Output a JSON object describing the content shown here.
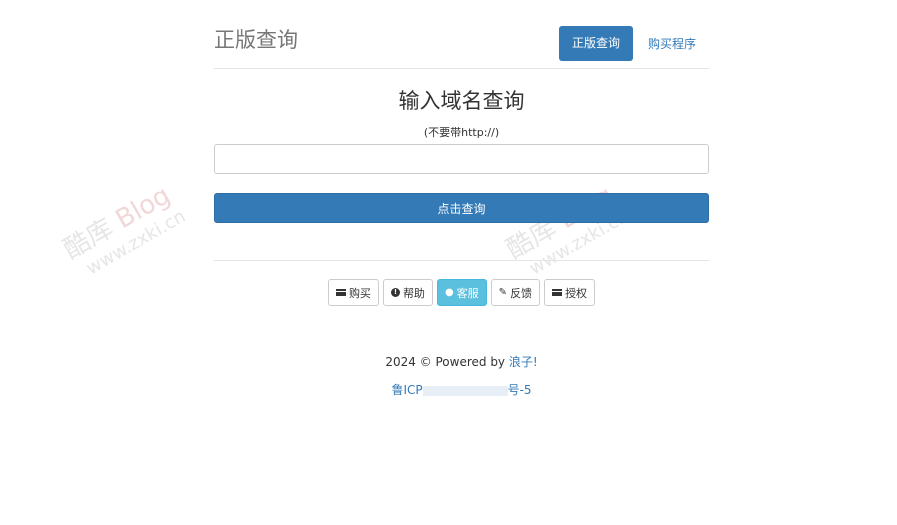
{
  "header": {
    "brand": "正版查询",
    "nav": {
      "active_label": "正版查询",
      "link_label": "购买程序"
    }
  },
  "main": {
    "title": "输入域名查询",
    "hint": "(不要带http://)",
    "input": {
      "value": "",
      "placeholder": ""
    },
    "submit_label": "点击查询"
  },
  "actions": [
    {
      "label": "购买",
      "icon": "card-icon"
    },
    {
      "label": "帮助",
      "icon": "help-circle-icon"
    },
    {
      "label": "客服",
      "icon": "user-icon"
    },
    {
      "label": "反馈",
      "icon": "pencil-icon"
    },
    {
      "label": "授权",
      "icon": "card-icon"
    }
  ],
  "footer": {
    "copyright": "2024 © Powered by",
    "author": "浪子!",
    "icp_prefix": "鲁ICP",
    "icp_suffix": "号-5"
  },
  "watermark": {
    "text_cn": "酷库",
    "text_blog": "Blog",
    "url": "www.zxki.cn"
  },
  "colors": {
    "primary": "#337ab7",
    "info": "#5bc0de",
    "border": "#e5e5e5"
  }
}
